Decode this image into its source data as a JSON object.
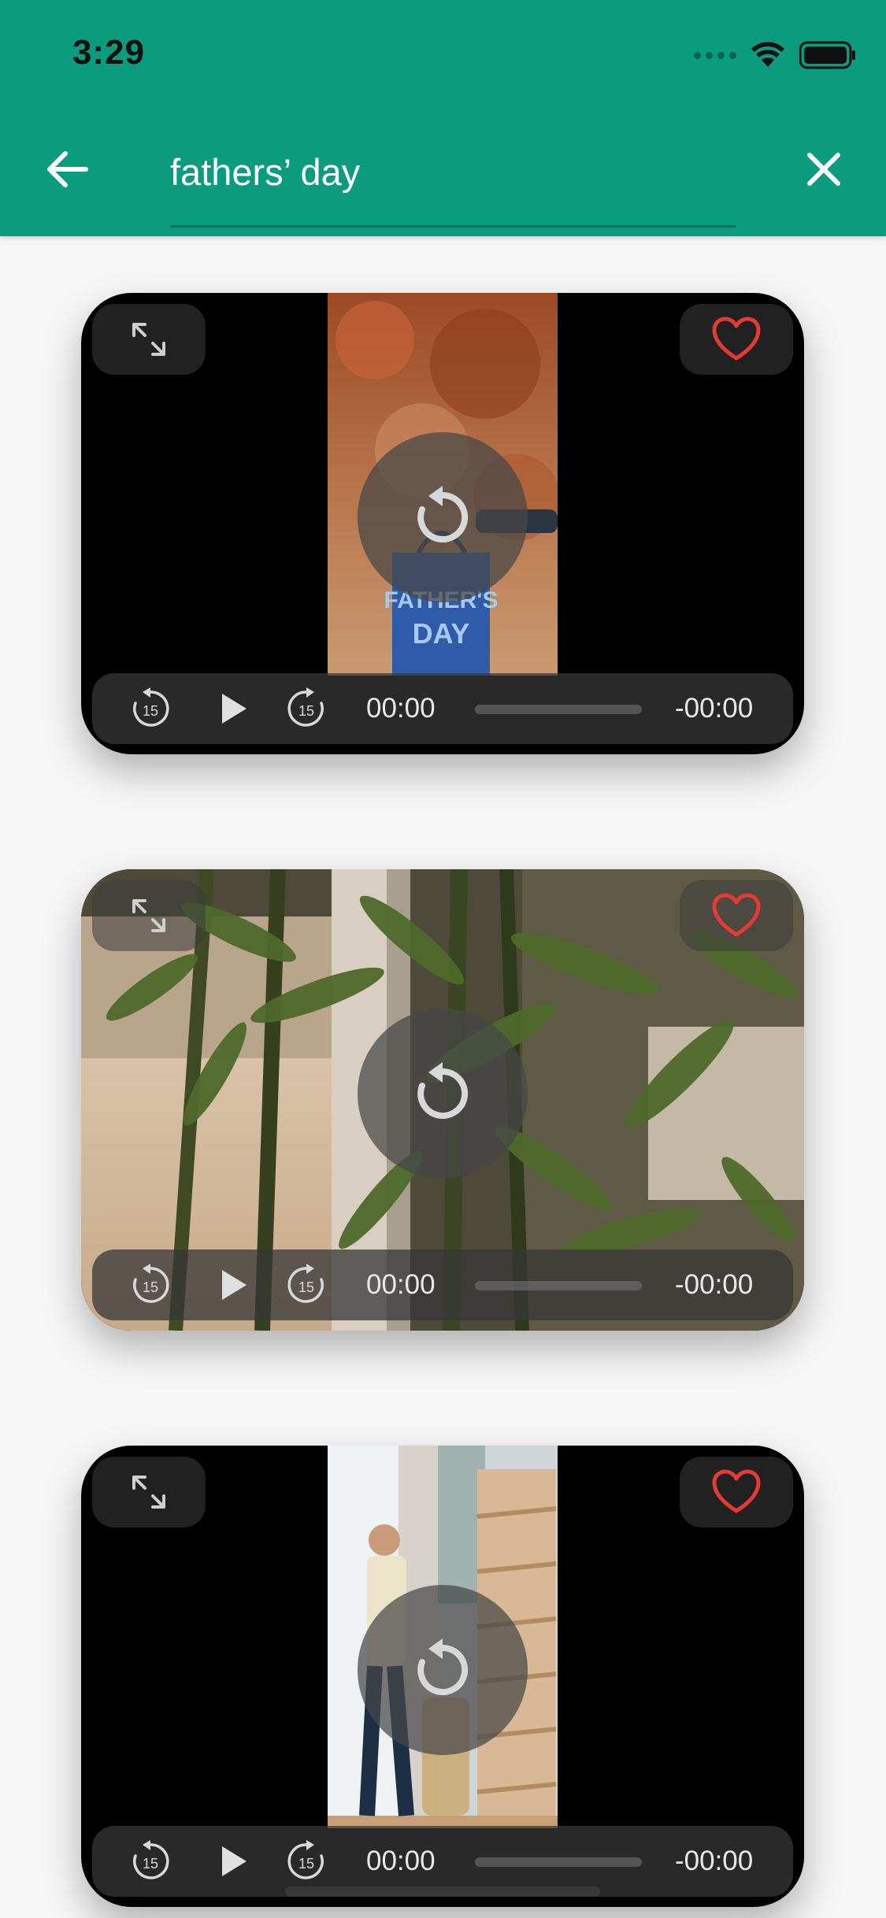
{
  "status_bar": {
    "time": "3:29"
  },
  "search": {
    "query": "fathers’ day",
    "back_icon": "arrow-left-icon",
    "clear_icon": "close-icon"
  },
  "colors": {
    "app_bar": "#0b9b7e",
    "heart": "#e53935",
    "background": "#f6f6f6"
  },
  "videos": [
    {
      "thumbnail": "fathers-day-gift-bag",
      "current_time": "00:00",
      "remaining_time": "-00:00",
      "progress": 0,
      "favorite": true
    },
    {
      "thumbnail": "bamboo-plant",
      "current_time": "00:00",
      "remaining_time": "-00:00",
      "progress": 0,
      "favorite": true
    },
    {
      "thumbnail": "father-and-child-walking",
      "current_time": "00:00",
      "remaining_time": "-00:00",
      "progress": 0,
      "favorite": true
    }
  ]
}
